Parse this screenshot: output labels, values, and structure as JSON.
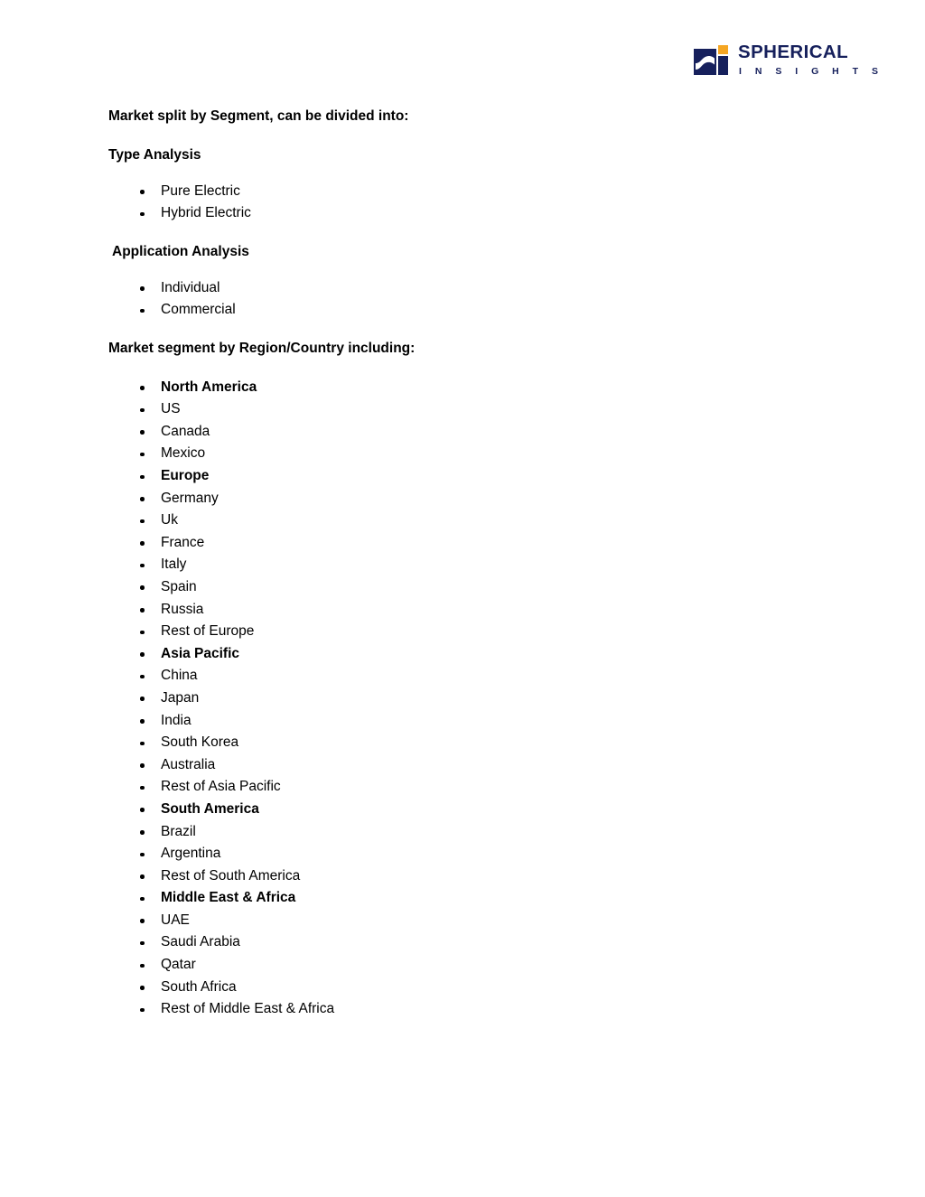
{
  "logo": {
    "primary": "SPHERICAL",
    "secondary": "I N S I G H T S",
    "mark_name": "spherical-insights-logo-mark",
    "colors": {
      "navy": "#16205c",
      "orange": "#f5a623",
      "white": "#ffffff"
    }
  },
  "document": {
    "intro_heading": "Market split by Segment, can be divided into:",
    "sections": [
      {
        "heading": "Type Analysis",
        "indented": false,
        "items": [
          {
            "label": "Pure Electric",
            "bold": false
          },
          {
            "label": "Hybrid Electric",
            "bold": false
          }
        ]
      },
      {
        "heading": "Application Analysis",
        "indented": true,
        "items": [
          {
            "label": "Individual",
            "bold": false
          },
          {
            "label": "Commercial",
            "bold": false
          }
        ]
      }
    ],
    "region_heading": "Market segment by Region/Country including:",
    "region_items": [
      {
        "label": "North America",
        "bold": true
      },
      {
        "label": "US",
        "bold": false
      },
      {
        "label": "Canada",
        "bold": false
      },
      {
        "label": "Mexico",
        "bold": false
      },
      {
        "label": "Europe",
        "bold": true
      },
      {
        "label": "Germany",
        "bold": false
      },
      {
        "label": "Uk",
        "bold": false
      },
      {
        "label": "France",
        "bold": false
      },
      {
        "label": "Italy",
        "bold": false
      },
      {
        "label": "Spain",
        "bold": false
      },
      {
        "label": "Russia",
        "bold": false
      },
      {
        "label": "Rest of Europe",
        "bold": false
      },
      {
        "label": "Asia Pacific",
        "bold": true
      },
      {
        "label": "China",
        "bold": false
      },
      {
        "label": "Japan",
        "bold": false
      },
      {
        "label": "India",
        "bold": false
      },
      {
        "label": "South Korea",
        "bold": false
      },
      {
        "label": "Australia",
        "bold": false
      },
      {
        "label": "Rest of Asia Pacific",
        "bold": false
      },
      {
        "label": "South America",
        "bold": true
      },
      {
        "label": "Brazil",
        "bold": false
      },
      {
        "label": "Argentina",
        "bold": false
      },
      {
        "label": "Rest of South America",
        "bold": false
      },
      {
        "label": "Middle East & Africa",
        "bold": true
      },
      {
        "label": "UAE",
        "bold": false
      },
      {
        "label": "Saudi Arabia",
        "bold": false
      },
      {
        "label": "Qatar",
        "bold": false
      },
      {
        "label": "South Africa",
        "bold": false
      },
      {
        "label": "Rest of Middle East & Africa",
        "bold": false
      }
    ]
  }
}
